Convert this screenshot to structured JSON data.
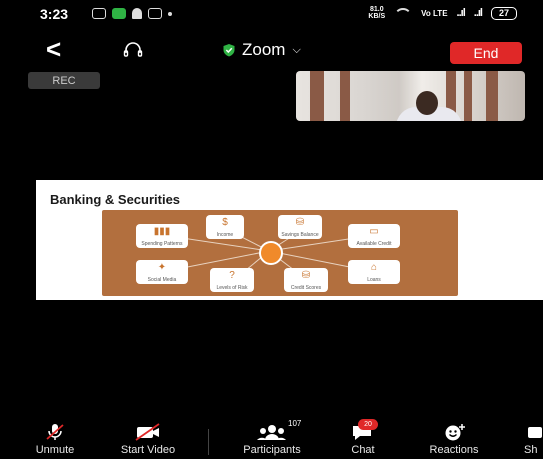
{
  "status_bar": {
    "time": "3:23",
    "data_rate": "81.0",
    "data_unit": "KB/S",
    "battery": "27"
  },
  "header": {
    "title": "Zoom",
    "end_label": "End"
  },
  "rec_label": "REC",
  "slide": {
    "title": "Banking & Securities",
    "nodes": [
      "Spending Patterns",
      "Income",
      "Savings Balance",
      "Available Credit",
      "Social Media",
      "Levels of Risk",
      "Credit Scores",
      "Loans"
    ],
    "glyphs": [
      "▮▮▮",
      "$",
      "⛁",
      "▭",
      "✦",
      "?",
      "⛁",
      "⌂"
    ]
  },
  "toolbar": {
    "unmute": "Unmute",
    "start_video": "Start Video",
    "participants": "Participants",
    "participants_count": "107",
    "chat": "Chat",
    "chat_count": "20",
    "reactions": "Reactions",
    "share": "Sh"
  },
  "colors": {
    "end_button": "#e02828",
    "shield": "#2fb344",
    "diagram_bg": "#b26f3e",
    "hub": "#f08a2a"
  }
}
